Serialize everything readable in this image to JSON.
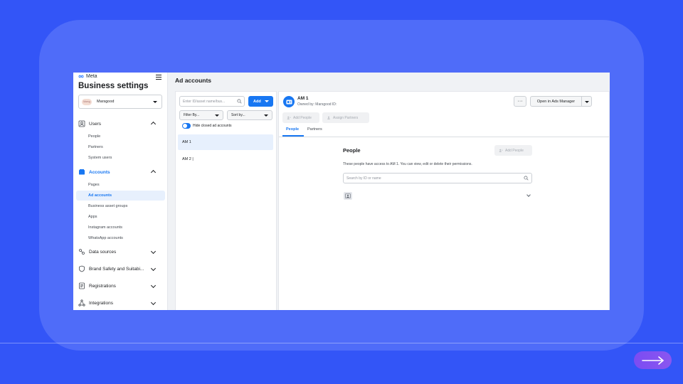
{
  "sidebar": {
    "brand": "Meta",
    "title": "Business settings",
    "business": {
      "avatar_text": "Marsg",
      "name": "Marsgood"
    },
    "sections": [
      {
        "label": "Users",
        "icon": "users-icon",
        "expanded": true,
        "items": [
          "People",
          "Partners",
          "System users"
        ]
      },
      {
        "label": "Accounts",
        "icon": "accounts-icon",
        "expanded": true,
        "active": true,
        "items": [
          "Pages",
          "Ad accounts",
          "Business asset groups",
          "Apps",
          "Instagram accounts",
          "WhatsApp accounts"
        ]
      },
      {
        "label": "Data sources",
        "icon": "data-sources-icon"
      },
      {
        "label": "Brand Safety and Suitabi...",
        "icon": "shield-icon"
      },
      {
        "label": "Registrations",
        "icon": "registrations-icon"
      },
      {
        "label": "Integrations",
        "icon": "integrations-icon"
      }
    ],
    "active_item": "Ad accounts"
  },
  "list": {
    "page_title": "Ad accounts",
    "search_placeholder": "Enter ID/asset name/bus...",
    "add_label": "Add",
    "filter_label": "Filter By...",
    "sort_label": "Sort by...",
    "toggle_label": "Hide closed ad accounts",
    "accounts": [
      "AM 1",
      "AM 2 |"
    ]
  },
  "detail": {
    "name": "AM 1",
    "owner": "Owned by: Marsgood  ID:",
    "more_label": "···",
    "open_label": "Open in Ads Manager",
    "add_people_label": "Add People",
    "assign_partners_label": "Assign Partners",
    "tabs": [
      "People",
      "Partners"
    ],
    "people_heading": "People",
    "people_desc": "These people have access to AM 1. You can view, edit or delete their permissions.",
    "people_search_placeholder": "Search by ID or name"
  },
  "colors": {
    "accent": "#1877f2",
    "background": "#3355f7",
    "card": "#4f6cf9",
    "next_button": "#7b4cf2"
  }
}
